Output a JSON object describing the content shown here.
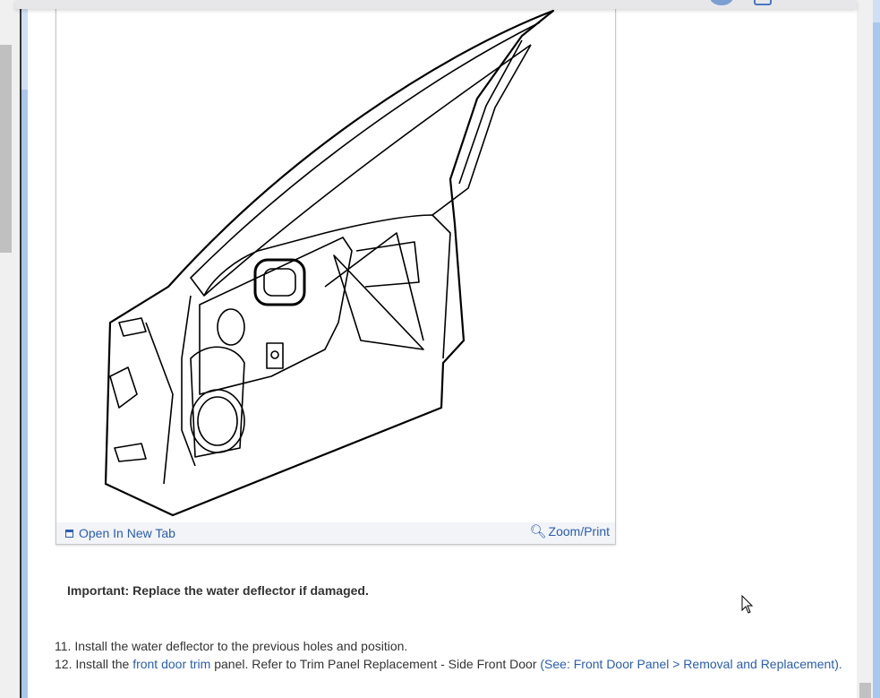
{
  "figure": {
    "open_new_tab_label": "Open In New Tab",
    "zoom_print_label": "Zoom/Print",
    "icons": {
      "open": "open-new-tab-icon",
      "zoom": "zoom-in-icon"
    }
  },
  "important_note": "Important: Replace the water deflector if damaged.",
  "steps": [
    {
      "number": "11.",
      "text": "Install the water deflector to the previous holes and position."
    },
    {
      "number": "12.",
      "pre": "Install the ",
      "link1": "front door trim",
      "mid": " panel. Refer to Trim Panel Replacement - Side Front Door ",
      "paren_open": "(See: ",
      "link2": "Front Door Panel > Removal and Replacement",
      "paren_close": ")."
    }
  ],
  "colors": {
    "link": "#2a5db0",
    "text": "#333333",
    "footer_bg": "#f3f4f8"
  }
}
